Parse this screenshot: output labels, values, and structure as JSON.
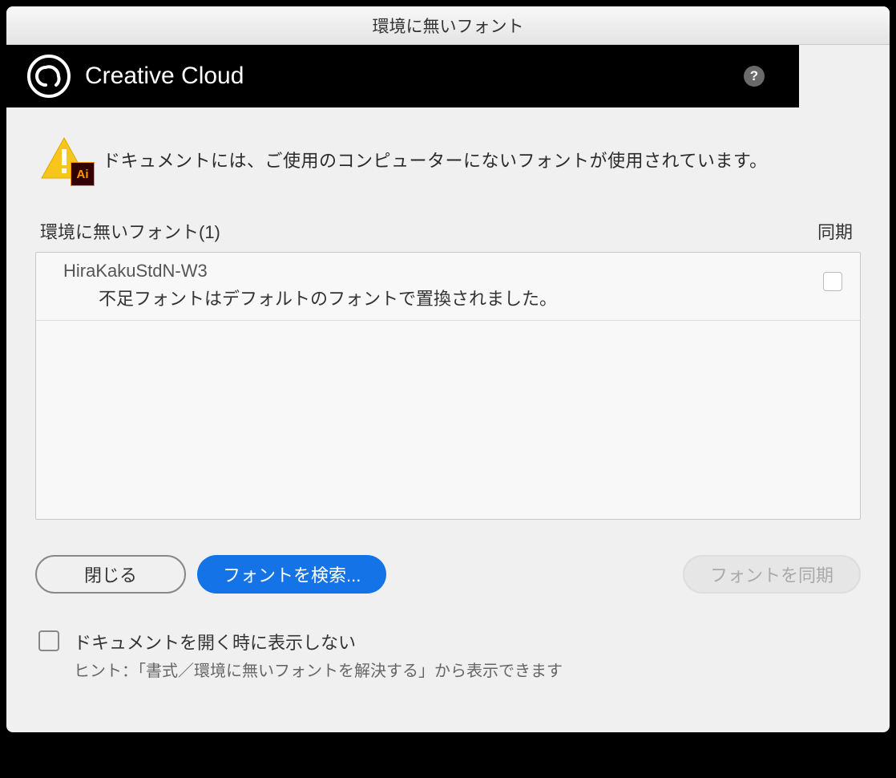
{
  "titlebar": "環境に無いフォント",
  "header": {
    "title": "Creative Cloud"
  },
  "warning": {
    "message": "ドキュメントには、ご使用のコンピューターにないフォントが使用されています。",
    "ai_badge": "Ai"
  },
  "columns": {
    "missing_fonts_label": "環境に無いフォント(1)",
    "sync_label": "同期"
  },
  "fonts": [
    {
      "name": "HiraKakuStdN-W3",
      "message": "不足フォントはデフォルトのフォントで置換されました。"
    }
  ],
  "buttons": {
    "close": "閉じる",
    "find_fonts": "フォントを検索...",
    "sync_fonts": "フォントを同期"
  },
  "dont_show": {
    "label": "ドキュメントを開く時に表示しない",
    "hint": "ヒント：「書式／環境に無いフォントを解決する」から表示できます"
  }
}
